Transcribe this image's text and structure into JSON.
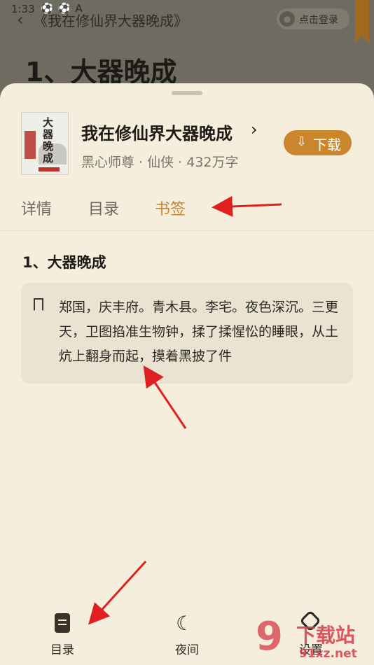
{
  "status_bar": {
    "time": "1:33",
    "icons": "⚽⚽A"
  },
  "reader": {
    "book_title": "《我在修仙界大器晚成》",
    "login_label": "点击登录",
    "chapter_title": "1、大器晚成"
  },
  "book": {
    "title": "我在修仙界大器晚成",
    "meta": "黑心师尊 · 仙侠 · 432万字",
    "download_label": "下载",
    "cover_text": "大器晚成"
  },
  "tabs": [
    {
      "label": "详情",
      "active": false
    },
    {
      "label": "目录",
      "active": false
    },
    {
      "label": "书签",
      "active": true
    }
  ],
  "bookmarks": {
    "chapter": "1、大器晚成",
    "items": [
      {
        "text": "郑国，庆丰府。青木县。李宅。夜色深沉。三更天，卫图掐准生物钟，揉了揉惺忪的睡眼，从土炕上翻身而起，摸着黑披了件"
      }
    ]
  },
  "bottom_nav": [
    {
      "label": "目录",
      "icon": "toc-icon"
    },
    {
      "label": "夜间",
      "icon": "moon-icon"
    },
    {
      "label": "设置",
      "icon": "gear-icon"
    }
  ],
  "watermark": {
    "mark": "9",
    "big": "下载站",
    "small": "91xz.net"
  },
  "colors": {
    "accent": "#c9862a",
    "sheet": "#f5eedd",
    "card": "#ebe3d2",
    "annotation": "#e02020"
  }
}
